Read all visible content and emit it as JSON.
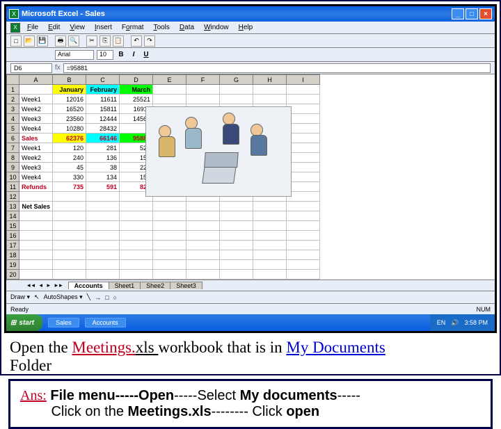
{
  "titlebar": {
    "app": "Microsoft Excel",
    "doc": "Sales"
  },
  "menubar": [
    "File",
    "Edit",
    "View",
    "Insert",
    "Format",
    "Tools",
    "Data",
    "Window",
    "Help"
  ],
  "formatbar": {
    "font": "Arial",
    "size": "10"
  },
  "namebox": {
    "cell": "D6",
    "formula": "=95881"
  },
  "columns": [
    "A",
    "B",
    "C",
    "D",
    "E",
    "F",
    "G",
    "H",
    "I"
  ],
  "headers": {
    "jan": "January",
    "feb": "February",
    "mar": "March"
  },
  "rows": {
    "r2": {
      "label": "Week1",
      "b": "12016",
      "c": "11611",
      "d": "25521"
    },
    "r3": {
      "label": "Week2",
      "b": "16520",
      "c": "15811",
      "d": "16911"
    },
    "r4": {
      "label": "Week3",
      "b": "23560",
      "c": "12444",
      "d": "14560"
    },
    "r5": {
      "label": "Week4",
      "b": "10280",
      "c": "28432",
      "d": ""
    },
    "sales": {
      "label": "Sales",
      "b": "62376",
      "c": "66146",
      "d": "95881"
    },
    "r7": {
      "label": "Week1",
      "b": "120",
      "c": "281",
      "d": "521"
    },
    "r8": {
      "label": "Week2",
      "b": "240",
      "c": "136",
      "d": "155"
    },
    "r9": {
      "label": "Week3",
      "b": "45",
      "c": "38",
      "d": "225"
    },
    "r10": {
      "label": "Week4",
      "b": "330",
      "c": "134",
      "d": "154"
    },
    "refunds": {
      "label": "Refunds",
      "b": "735",
      "c": "591",
      "d": "824"
    },
    "netsales": {
      "label": "Net Sales"
    }
  },
  "tabs": [
    "Accounts",
    "Sheet1",
    "Shee2",
    "Sheet3"
  ],
  "drawbar": {
    "draw": "Draw ▾",
    "autoshapes": "AutoShapes ▾"
  },
  "statusbar": {
    "ready": "Ready",
    "num": "NUM"
  },
  "taskbar": {
    "start": "start",
    "items": [
      "Sales",
      "Accounts"
    ],
    "tray": {
      "lang": "EN",
      "time": "3:58 PM"
    }
  },
  "question": {
    "prefix": "Open the ",
    "file": "Meetings.",
    "file2": "xls ",
    "mid": "workbook that is in ",
    "loc": "My Documents",
    "suffix": " Folder"
  },
  "answer": {
    "ans": "Ans:",
    "l1a": " File menu-----",
    "l1b": "Open",
    "l1c": "-----Select  ",
    "l1d": "My documents",
    "l1e": "-----",
    "l2a": "Click on the ",
    "l2b": "Meetings.",
    "l2c": "xls",
    "l2d": "-------- Click ",
    "l2e": "open"
  }
}
